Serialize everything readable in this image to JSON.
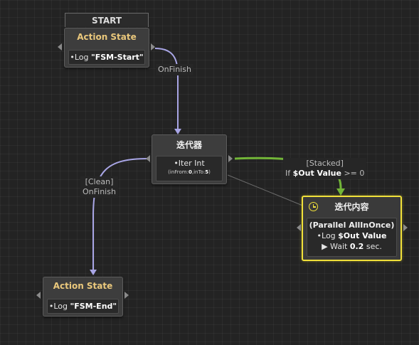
{
  "start_tag": "START",
  "nodes": {
    "action_start": {
      "title": "Action State",
      "line_prefix": "•Log ",
      "line_value": "\"FSM-Start\""
    },
    "iterator": {
      "title": "迭代器",
      "line": "•Iter Int",
      "params_open": "(inFrom:",
      "from": "0",
      "sep": ",inTo:",
      "to": "5",
      "params_close": ")"
    },
    "iter_content": {
      "title": "迭代内容",
      "line1": "(Parallel AllInOnce)",
      "line2_prefix": "•Log ",
      "line2_value": "$Out Value",
      "line3_prefix": "▶ Wait ",
      "line3_value": "0.2",
      "line3_suffix": " sec."
    },
    "action_end": {
      "title": "Action State",
      "line_prefix": "•Log ",
      "line_value": "\"FSM-End\""
    }
  },
  "transitions": {
    "on_finish": "OnFinish",
    "clean_line1": "[Clean]",
    "clean_line2": "OnFinish",
    "stacked_line1": "[Stacked]",
    "stacked_prefix": "If ",
    "stacked_var": "$Out Value",
    "stacked_cond": " >= 0"
  },
  "colors": {
    "background": "#232323",
    "node_title": "#eac87c",
    "active_outline": "#f1e13a",
    "wire_default": "#a9a6e6",
    "wire_active": "#72b538",
    "wire_dim": "#6a6a6a"
  }
}
